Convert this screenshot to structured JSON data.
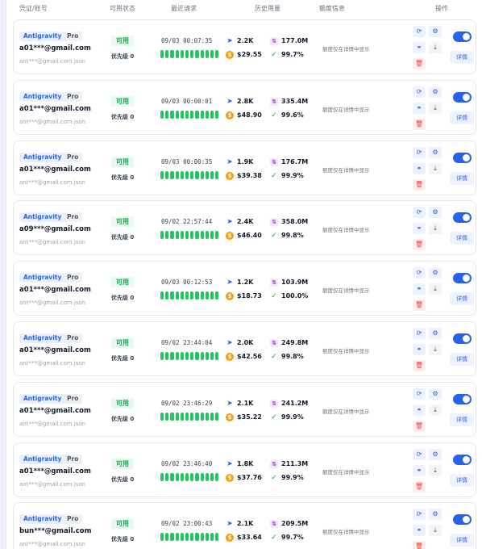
{
  "header": {
    "col_credential": "凭证/账号",
    "col_status": "可用状态",
    "col_recent": "最近请求",
    "col_usage": "历史用量",
    "col_quota": "额度信息",
    "col_actions": "操作"
  },
  "accounts": [
    {
      "brand": "Antigravity",
      "tier": "Pro",
      "email": "a01***@gmail.com",
      "file": "ant***@gmail.com.json",
      "status": "可用",
      "priority": "优先级 0",
      "last_request": "09/03 00:07:35",
      "requests": "2.2K",
      "tokens": "177.0M",
      "cost": "$29.55",
      "success_rate": "99.7%",
      "quota_note": "额度仅在详情中显示",
      "detail_label": "详情"
    },
    {
      "brand": "Antigravity",
      "tier": "Pro",
      "email": "a01***@gmail.com",
      "file": "ant***@gmail.com.json",
      "status": "可用",
      "priority": "优先级 0",
      "last_request": "09/03 00:00:01",
      "requests": "2.8K",
      "tokens": "335.4M",
      "cost": "$48.90",
      "success_rate": "99.6%",
      "quota_note": "额度仅在详情中显示",
      "detail_label": "详情"
    },
    {
      "brand": "Antigravity",
      "tier": "Pro",
      "email": "a01***@gmail.com",
      "file": "ant***@gmail.com.json",
      "status": "可用",
      "priority": "优先级 0",
      "last_request": "09/03 00:00:35",
      "requests": "1.9K",
      "tokens": "176.7M",
      "cost": "$39.38",
      "success_rate": "99.9%",
      "quota_note": "额度仅在详情中显示",
      "detail_label": "详情"
    },
    {
      "brand": "Antigravity",
      "tier": "Pro",
      "email": "a09***@gmail.com",
      "file": "ant***@gmail.com.json",
      "status": "可用",
      "priority": "优先级 0",
      "last_request": "09/02 22:57:44",
      "requests": "2.4K",
      "tokens": "358.0M",
      "cost": "$46.40",
      "success_rate": "99.8%",
      "quota_note": "额度仅在详情中显示",
      "detail_label": "详情"
    },
    {
      "brand": "Antigravity",
      "tier": "Pro",
      "email": "a01***@gmail.com",
      "file": "ant***@gmail.com.json",
      "status": "可用",
      "priority": "优先级 0",
      "last_request": "09/03 00:12:53",
      "requests": "1.2K",
      "tokens": "103.9M",
      "cost": "$18.73",
      "success_rate": "100.0%",
      "quota_note": "额度仅在详情中显示",
      "detail_label": "详情"
    },
    {
      "brand": "Antigravity",
      "tier": "Pro",
      "email": "a01***@gmail.com",
      "file": "ant***@gmail.com.json",
      "status": "可用",
      "priority": "优先级 0",
      "last_request": "09/02 23:44:04",
      "requests": "2.0K",
      "tokens": "249.8M",
      "cost": "$42.56",
      "success_rate": "99.8%",
      "quota_note": "额度仅在详情中显示",
      "detail_label": "详情"
    },
    {
      "brand": "Antigravity",
      "tier": "Pro",
      "email": "a01***@gmail.com",
      "file": "ant***@gmail.com.json",
      "status": "可用",
      "priority": "优先级 0",
      "last_request": "09/02 23:46:29",
      "requests": "2.1K",
      "tokens": "241.2M",
      "cost": "$35.22",
      "success_rate": "99.9%",
      "quota_note": "额度仅在详情中显示",
      "detail_label": "详情"
    },
    {
      "brand": "Antigravity",
      "tier": "Pro",
      "email": "a01***@gmail.com",
      "file": "ant***@gmail.com.json",
      "status": "可用",
      "priority": "优先级 0",
      "last_request": "09/02 23:46:40",
      "requests": "1.8K",
      "tokens": "211.3M",
      "cost": "$37.76",
      "success_rate": "99.9%",
      "quota_note": "额度仅在详情中显示",
      "detail_label": "详情"
    },
    {
      "brand": "Antigravity",
      "tier": "Pro",
      "email": "bun***@gmail.com",
      "file": "ant***@gmail.com.json",
      "status": "可用",
      "priority": "优先级 0",
      "last_request": "09/02 23:00:43",
      "requests": "2.1K",
      "tokens": "209.5M",
      "cost": "$33.64",
      "success_rate": "99.7%",
      "quota_note": "额度仅在详情中显示",
      "detail_label": "详情"
    }
  ],
  "health_segments": 12,
  "icons": {
    "requests": "send-icon",
    "tokens": "tokens-icon",
    "cost": "dollar-icon",
    "success": "check-icon",
    "refresh": "refresh-icon",
    "settings": "gear-icon",
    "link": "link-icon",
    "download": "download-icon",
    "delete": "trash-icon"
  },
  "colors": {
    "accent": "#2563eb",
    "success": "#22c55e",
    "danger": "#ef4444",
    "cost": "#f59e0b",
    "tokens": "#9333ea"
  }
}
